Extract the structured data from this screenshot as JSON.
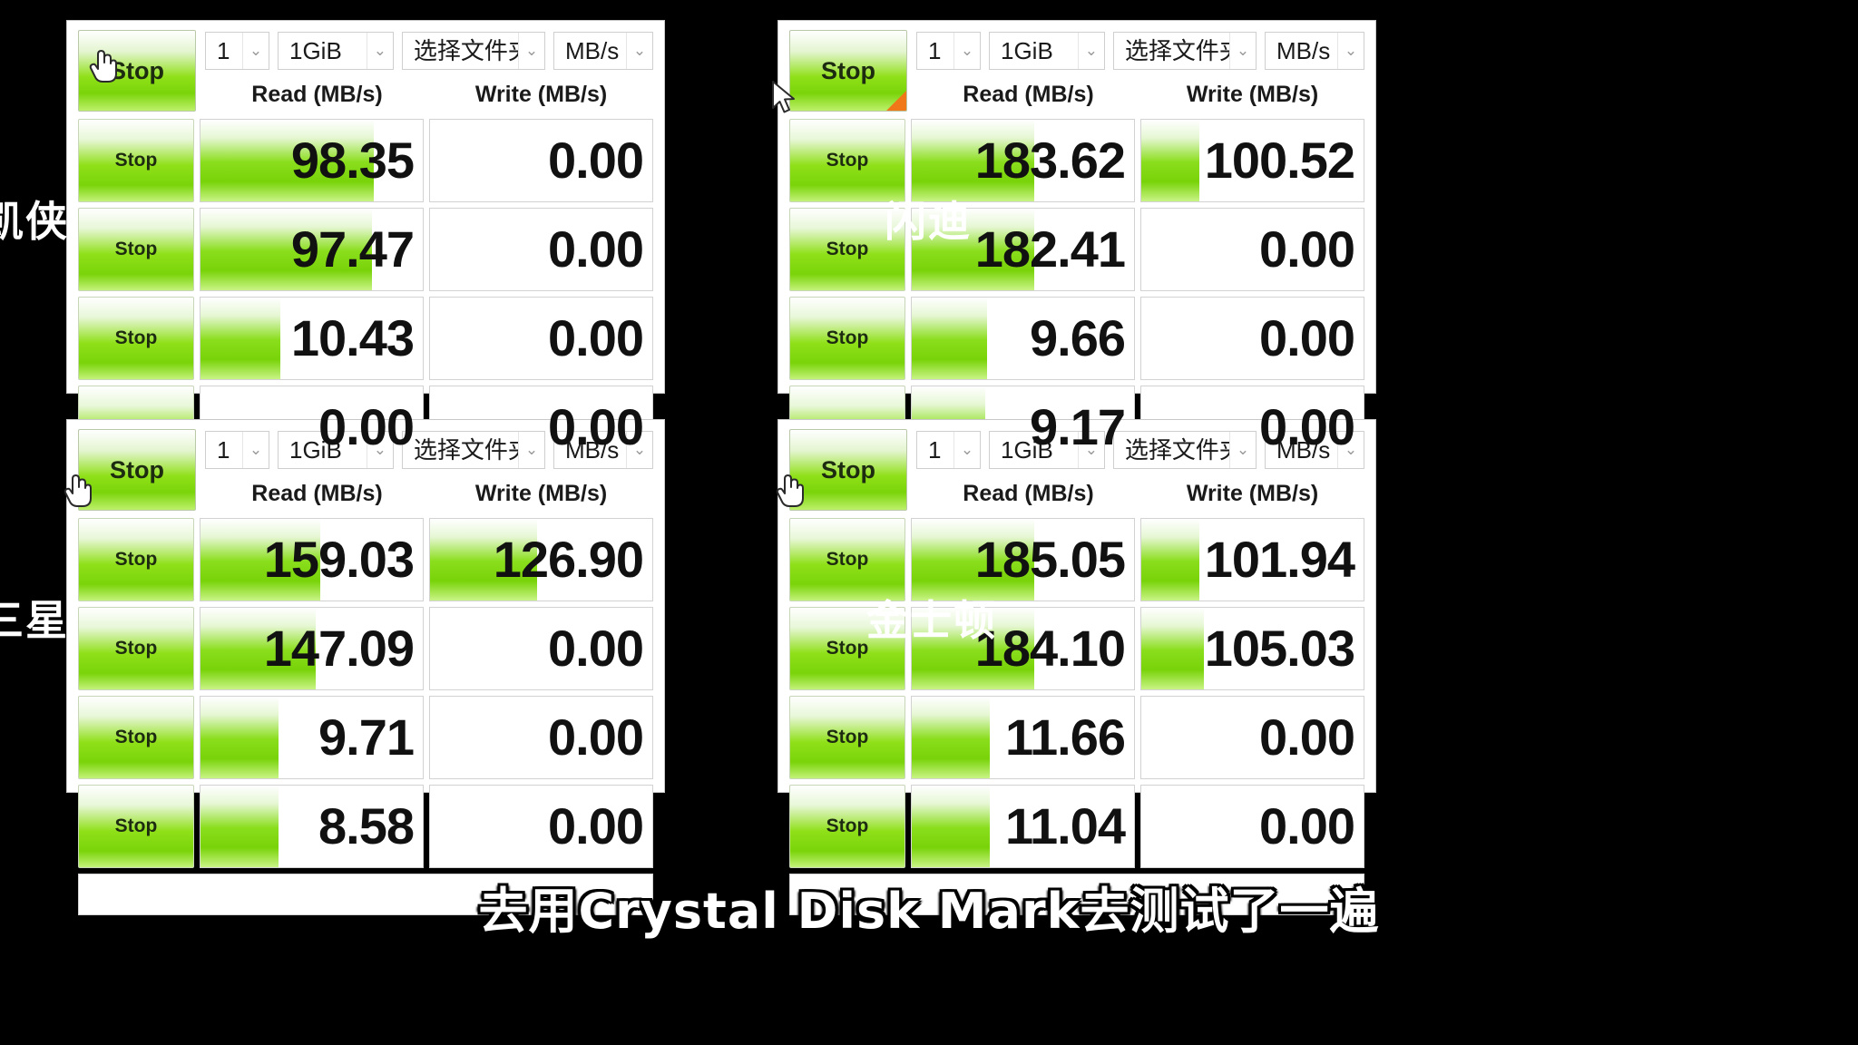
{
  "background_color": "#000000",
  "accent_color": "#8ade1c",
  "flag_color": "#f07818",
  "subtitle": {
    "text": "去用Crystal Disk Mark去测试了一遍"
  },
  "common": {
    "all_button_label": "Stop",
    "row_button_label": "Stop",
    "count_value": "1",
    "size_value": "1GiB",
    "folder_value": "选择文件夹",
    "unit_value": "MB/s",
    "read_header": "Read (MB/s)",
    "write_header": "Write (MB/s)",
    "dropdown_arrow": "⌄"
  },
  "panels": [
    {
      "id": "panel-top-left",
      "brand": "凯侠",
      "cursor": "hand-pointer",
      "corner_flag": false,
      "rows": [
        {
          "read": "98.35",
          "read_pct": 78,
          "write": "0.00",
          "write_pct": 0
        },
        {
          "read": "97.47",
          "read_pct": 77,
          "write": "0.00",
          "write_pct": 0
        },
        {
          "read": "10.43",
          "read_pct": 36,
          "write": "0.00",
          "write_pct": 0
        },
        {
          "read": "0.00",
          "read_pct": 0,
          "write": "0.00",
          "write_pct": 0
        }
      ]
    },
    {
      "id": "panel-top-right",
      "brand": "闪迪",
      "cursor": "arrow",
      "corner_flag": true,
      "rows": [
        {
          "read": "183.62",
          "read_pct": 55,
          "write": "100.52",
          "write_pct": 26
        },
        {
          "read": "182.41",
          "read_pct": 55,
          "write": "0.00",
          "write_pct": 0
        },
        {
          "read": "9.66",
          "read_pct": 34,
          "write": "0.00",
          "write_pct": 0
        },
        {
          "read": "9.17",
          "read_pct": 33,
          "write": "0.00",
          "write_pct": 0
        }
      ]
    },
    {
      "id": "panel-bottom-left",
      "brand": "三星",
      "cursor": "hand-pointer",
      "corner_flag": false,
      "rows": [
        {
          "read": "159.03",
          "read_pct": 54,
          "write": "126.90",
          "write_pct": 48
        },
        {
          "read": "147.09",
          "read_pct": 52,
          "write": "0.00",
          "write_pct": 0
        },
        {
          "read": "9.71",
          "read_pct": 35,
          "write": "0.00",
          "write_pct": 0
        },
        {
          "read": "8.58",
          "read_pct": 35,
          "write": "0.00",
          "write_pct": 0
        }
      ]
    },
    {
      "id": "panel-bottom-right",
      "brand": "金士顿",
      "cursor": "hand-pointer",
      "corner_flag": false,
      "rows": [
        {
          "read": "185.05",
          "read_pct": 55,
          "write": "101.94",
          "write_pct": 26
        },
        {
          "read": "184.10",
          "read_pct": 55,
          "write": "105.03",
          "write_pct": 28
        },
        {
          "read": "11.66",
          "read_pct": 35,
          "write": "0.00",
          "write_pct": 0
        },
        {
          "read": "11.04",
          "read_pct": 35,
          "write": "0.00",
          "write_pct": 0
        }
      ]
    }
  ]
}
